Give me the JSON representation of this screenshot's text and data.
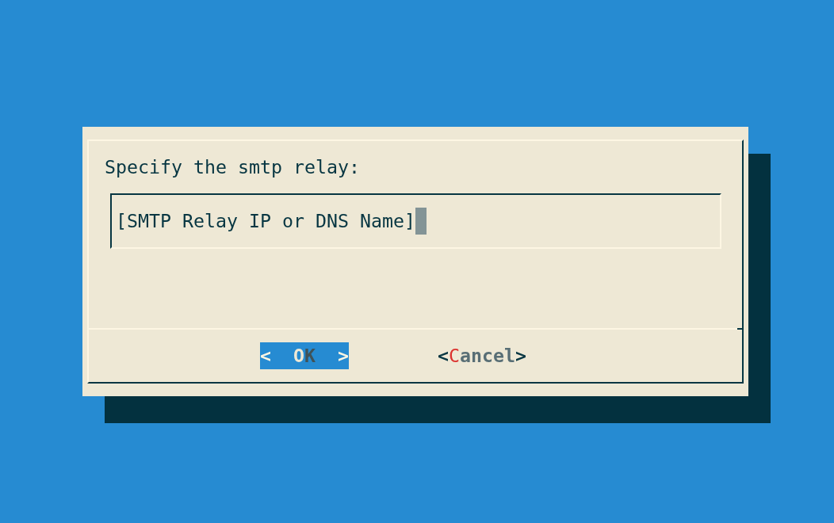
{
  "dialog": {
    "prompt": "Specify the smtp relay:",
    "input": {
      "value": "[SMTP Relay IP or DNS Name]",
      "cursor": true
    },
    "buttons": [
      {
        "left": "<",
        "hotkey": "O",
        "rest": "K",
        "right": ">",
        "selected": true
      },
      {
        "left": "<",
        "hotkey": "C",
        "rest": "ancel",
        "right": ">",
        "selected": false
      }
    ]
  }
}
